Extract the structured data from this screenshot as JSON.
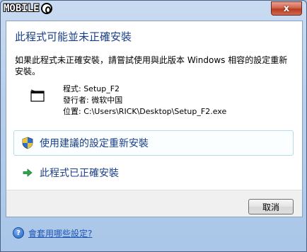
{
  "titlebar": {
    "logo_text": "MOBILE",
    "close_label": "x"
  },
  "dialog": {
    "heading": "此程式可能並未正確安裝",
    "description": "如果此程式未正確安裝，請嘗試使用與此版本 Windows 相容的設定重新安裝。",
    "program": {
      "name": "程式: Setup_F2",
      "publisher": "發行者: 微软中国",
      "location": "位置: C:\\Users\\RICK\\Desktop\\Setup_F2.exe"
    },
    "options": [
      {
        "label": "使用建議的設定重新安裝",
        "icon": "uac-shield-icon"
      },
      {
        "label": "此程式已正確安裝",
        "icon": "green-arrow-icon"
      }
    ],
    "cancel_label": "取消",
    "help_link": "會套用哪些設定?"
  },
  "colors": {
    "heading": "#1a3f8a",
    "link": "#1f56b5",
    "close_button": "#c8452d"
  }
}
